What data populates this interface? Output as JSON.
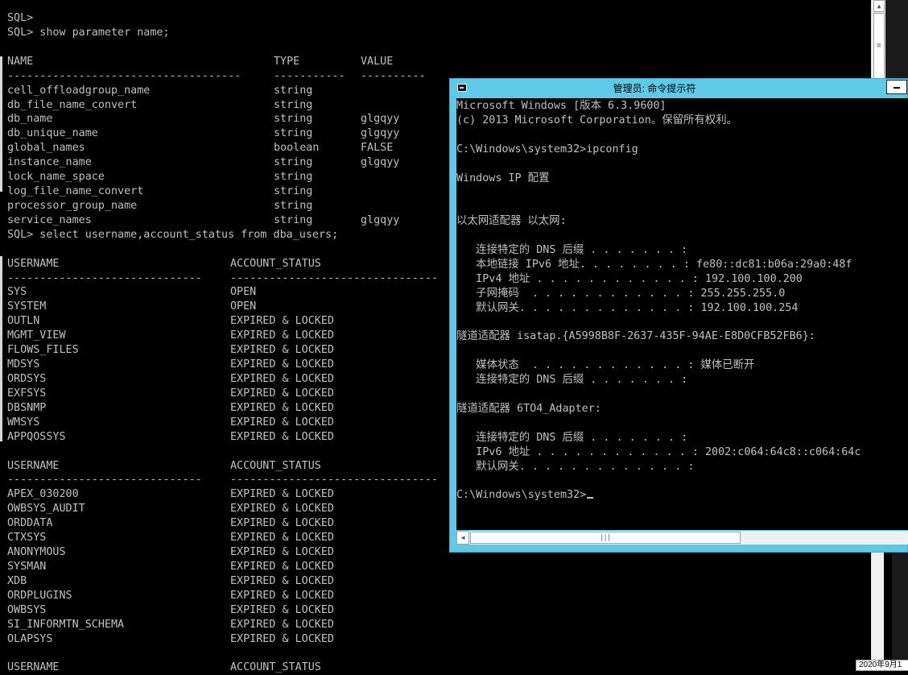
{
  "back_console": {
    "lines": [
      {
        "type": "text",
        "text": "SQL>"
      },
      {
        "type": "text",
        "text": "SQL> show parameter name;"
      },
      {
        "type": "blank"
      },
      {
        "type": "header",
        "cols": [
          "NAME",
          "TYPE",
          "VALUE"
        ]
      },
      {
        "type": "rule",
        "cols": [
          "------------------------------------",
          "-----------",
          "----------"
        ]
      },
      {
        "type": "row",
        "cols": [
          "cell_offloadgroup_name",
          "string",
          ""
        ]
      },
      {
        "type": "row",
        "cols": [
          "db_file_name_convert",
          "string",
          ""
        ]
      },
      {
        "type": "row",
        "cols": [
          "db_name",
          "string",
          "glgqyy"
        ]
      },
      {
        "type": "row",
        "cols": [
          "db_unique_name",
          "string",
          "glgqyy"
        ]
      },
      {
        "type": "row",
        "cols": [
          "global_names",
          "boolean",
          "FALSE"
        ]
      },
      {
        "type": "row",
        "cols": [
          "instance_name",
          "string",
          "glgqyy"
        ]
      },
      {
        "type": "row",
        "cols": [
          "lock_name_space",
          "string",
          ""
        ]
      },
      {
        "type": "row",
        "cols": [
          "log_file_name_convert",
          "string",
          ""
        ]
      },
      {
        "type": "row",
        "cols": [
          "processor_group_name",
          "string",
          ""
        ]
      },
      {
        "type": "row",
        "cols": [
          "service_names",
          "string",
          "glgqyy"
        ]
      },
      {
        "type": "text",
        "text": "SQL> select username,account_status from dba_users;"
      },
      {
        "type": "blank"
      },
      {
        "type": "header2",
        "cols": [
          "USERNAME",
          "ACCOUNT_STATUS"
        ]
      },
      {
        "type": "rule2",
        "cols": [
          "------------------------------",
          "--------------------------------"
        ]
      },
      {
        "type": "row2",
        "cols": [
          "SYS",
          "OPEN"
        ]
      },
      {
        "type": "row2",
        "cols": [
          "SYSTEM",
          "OPEN"
        ]
      },
      {
        "type": "row2",
        "cols": [
          "OUTLN",
          "EXPIRED & LOCKED"
        ]
      },
      {
        "type": "row2",
        "cols": [
          "MGMT_VIEW",
          "EXPIRED & LOCKED"
        ]
      },
      {
        "type": "row2",
        "cols": [
          "FLOWS_FILES",
          "EXPIRED & LOCKED"
        ]
      },
      {
        "type": "row2",
        "cols": [
          "MDSYS",
          "EXPIRED & LOCKED"
        ]
      },
      {
        "type": "row2",
        "cols": [
          "ORDSYS",
          "EXPIRED & LOCKED"
        ]
      },
      {
        "type": "row2",
        "cols": [
          "EXFSYS",
          "EXPIRED & LOCKED"
        ]
      },
      {
        "type": "row2",
        "cols": [
          "DBSNMP",
          "EXPIRED & LOCKED"
        ]
      },
      {
        "type": "row2",
        "cols": [
          "WMSYS",
          "EXPIRED & LOCKED"
        ]
      },
      {
        "type": "row2",
        "cols": [
          "APPQOSSYS",
          "EXPIRED & LOCKED"
        ]
      },
      {
        "type": "blank"
      },
      {
        "type": "header2",
        "cols": [
          "USERNAME",
          "ACCOUNT_STATUS"
        ]
      },
      {
        "type": "rule2",
        "cols": [
          "------------------------------",
          "--------------------------------"
        ]
      },
      {
        "type": "row2",
        "cols": [
          "APEX_030200",
          "EXPIRED & LOCKED"
        ]
      },
      {
        "type": "row2",
        "cols": [
          "OWBSYS_AUDIT",
          "EXPIRED & LOCKED"
        ]
      },
      {
        "type": "row2",
        "cols": [
          "ORDDATA",
          "EXPIRED & LOCKED"
        ]
      },
      {
        "type": "row2",
        "cols": [
          "CTXSYS",
          "EXPIRED & LOCKED"
        ]
      },
      {
        "type": "row2",
        "cols": [
          "ANONYMOUS",
          "EXPIRED & LOCKED"
        ]
      },
      {
        "type": "row2",
        "cols": [
          "SYSMAN",
          "EXPIRED & LOCKED"
        ]
      },
      {
        "type": "row2",
        "cols": [
          "XDB",
          "EXPIRED & LOCKED"
        ]
      },
      {
        "type": "row2",
        "cols": [
          "ORDPLUGINS",
          "EXPIRED & LOCKED"
        ]
      },
      {
        "type": "row2",
        "cols": [
          "OWBSYS",
          "EXPIRED & LOCKED"
        ]
      },
      {
        "type": "row2",
        "cols": [
          "SI_INFORMTN_SCHEMA",
          "EXPIRED & LOCKED"
        ]
      },
      {
        "type": "row2",
        "cols": [
          "OLAPSYS",
          "EXPIRED & LOCKED"
        ]
      },
      {
        "type": "blank"
      },
      {
        "type": "header2",
        "cols": [
          "USERNAME",
          "ACCOUNT_STATUS"
        ]
      }
    ]
  },
  "cmd_window": {
    "title": "管理员: 命令提示符",
    "lines": [
      "Microsoft Windows [版本 6.3.9600]",
      "(c) 2013 Microsoft Corporation。保留所有权利。",
      "",
      "C:\\Windows\\system32>ipconfig",
      "",
      "Windows IP 配置",
      "",
      "",
      "以太网适配器 以太网:",
      "",
      "   连接特定的 DNS 后缀 . . . . . . . :",
      "   本地链接 IPv6 地址. . . . . . . . : fe80::dc81:b06a:29a0:48f",
      "   IPv4 地址 . . . . . . . . . . . . : 192.100.100.200",
      "   子网掩码  . . . . . . . . . . . . : 255.255.255.0",
      "   默认网关. . . . . . . . . . . . . : 192.100.100.254",
      "",
      "隧道适配器 isatap.{A5998B8F-2637-435F-94AE-E8D0CFB52FB6}:",
      "",
      "   媒体状态  . . . . . . . . . . . . : 媒体已断开",
      "   连接特定的 DNS 后缀 . . . . . . . :",
      "",
      "隧道适配器 6TO4_Adapter:",
      "",
      "   连接特定的 DNS 后缀 . . . . . . . :",
      "   IPv6 地址 . . . . . . . . . . . . : 2002:c064:64c8::c064:64c",
      "   默认网关. . . . . . . . . . . . . :",
      "",
      "C:\\Windows\\system32>"
    ]
  },
  "taskbar": {
    "clock_text": "2020年9月1"
  },
  "icons": {
    "scroll_up": "up-arrow-icon",
    "scroll_left": "left-arrow-icon",
    "grip": "grip-icon",
    "cmd": "cmd-icon",
    "minimize": "minimize-icon"
  },
  "colors": {
    "console_bg": "#000000",
    "console_text": "#c0c0c0",
    "window_frame": "#5ecae8"
  }
}
